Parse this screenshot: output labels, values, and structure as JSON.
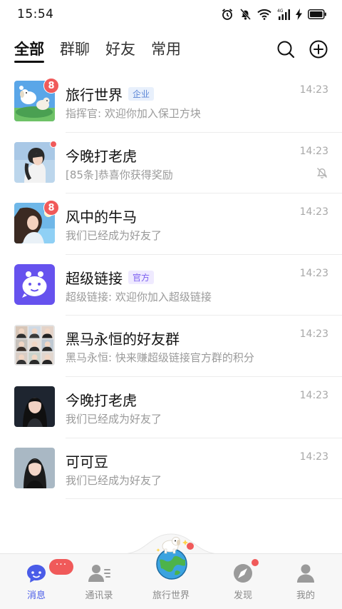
{
  "status_bar": {
    "time": "15:54",
    "icons": [
      "alarm-icon",
      "mute-bell-icon",
      "wifi-icon",
      "cellular-4g-icon",
      "charging-icon",
      "battery-icon"
    ]
  },
  "top_tabs": [
    {
      "label": "全部",
      "active": true
    },
    {
      "label": "群聊",
      "active": false
    },
    {
      "label": "好友",
      "active": false
    },
    {
      "label": "常用",
      "active": false
    }
  ],
  "top_actions": [
    "search-icon",
    "add-circle-icon"
  ],
  "chats": [
    {
      "name": "旅行世界",
      "tag": "企业",
      "preview": "指挥官: 欢迎你加入保卫方块",
      "time": "14:23",
      "badge": "8"
    },
    {
      "name": "今晚打老虎",
      "tag": "",
      "preview": "[85条]恭喜你获得奖励",
      "time": "14:23",
      "badge": "dot",
      "muted": true
    },
    {
      "name": "风中的牛马",
      "tag": "",
      "preview": "我们已经成为好友了",
      "time": "14:23",
      "badge": "8"
    },
    {
      "name": "超级链接",
      "tag": "官方",
      "preview": "超级链接: 欢迎你加入超级链接",
      "time": "14:23",
      "badge": ""
    },
    {
      "name": "黑马永恒的好友群",
      "tag": "",
      "preview": "黑马永恒: 快来赚超级链接官方群的积分",
      "time": "14:23",
      "badge": ""
    },
    {
      "name": "今晚打老虎",
      "tag": "",
      "preview": "我们已经成为好友了",
      "time": "14:23",
      "badge": ""
    },
    {
      "name": "可可豆",
      "tag": "",
      "preview": "我们已经成为好友了",
      "time": "14:23",
      "badge": ""
    }
  ],
  "bottom_nav": {
    "messages": {
      "label": "消息",
      "bubble": "···"
    },
    "contacts": {
      "label": "通讯录"
    },
    "travel_world": {
      "label": "旅行世界"
    },
    "discover": {
      "label": "发现"
    },
    "me": {
      "label": "我的"
    }
  },
  "colors": {
    "accent": "#4a5ce8",
    "badge_red": "#f05a5a",
    "tag_enterprise": "#5b86d6",
    "tag_official": "#7b5ef0"
  }
}
